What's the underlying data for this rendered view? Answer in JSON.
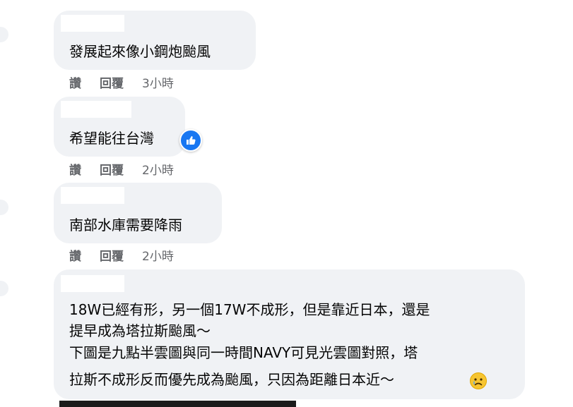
{
  "comments": [
    {
      "text": "發展起來像小鋼炮颱風",
      "like_label": "讚",
      "reply_label": "回覆",
      "time": "3小時"
    },
    {
      "text": "希望能往台灣",
      "like_label": "讚",
      "reply_label": "回覆",
      "time": "2小時",
      "reaction": "like-icon"
    },
    {
      "text": "南部水庫需要降雨",
      "like_label": "讚",
      "reply_label": "回覆",
      "time": "2小時"
    },
    {
      "lines": [
        "18W已經有形，另一個17W不成形，但是靠近日本，還是",
        "提早成為塔拉斯颱風～",
        "下圖是九點半雲圖與同一時間NAVY可見光雲圖對照，塔",
        "拉斯不成形反而優先成為颱風，只因為距離日本近～"
      ],
      "emoji": "sad-face-emoji"
    }
  ],
  "colors": {
    "bubble": "#f0f2f5",
    "text": "#050505",
    "meta": "#65676b",
    "like_blue": "#1877f2"
  }
}
